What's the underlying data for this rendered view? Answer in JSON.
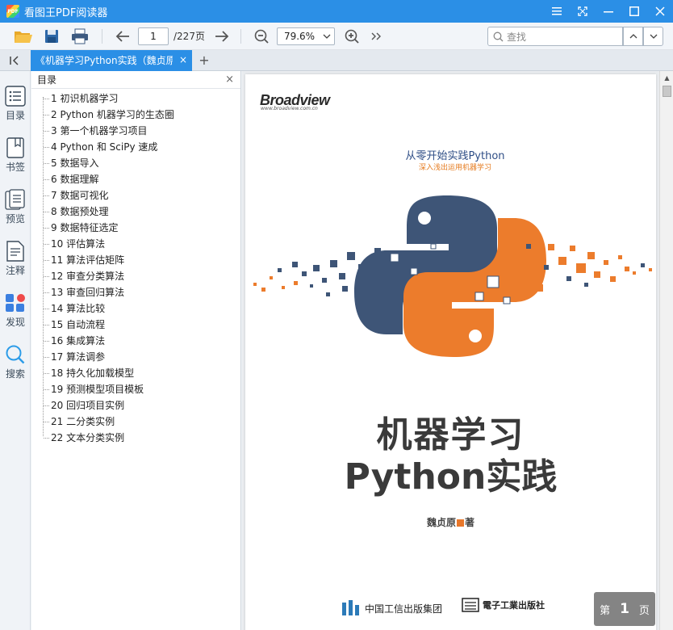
{
  "app": {
    "title": "看图王PDF阅读器",
    "logo_text": "PDF"
  },
  "window_controls": [
    "menu",
    "fullscreen",
    "minimize",
    "maximize",
    "close"
  ],
  "toolbar": {
    "current_page": "1",
    "total_pages": "/227页",
    "zoom": "79.6%",
    "search_placeholder": "查找"
  },
  "tab": {
    "label": "《机器学习Python实践（魏贞原",
    "close": "×",
    "add": "+",
    "collapse": "|<"
  },
  "rail": [
    {
      "label": "目录",
      "icon": "toc-icon"
    },
    {
      "label": "书签",
      "icon": "bookmark-icon"
    },
    {
      "label": "预览",
      "icon": "preview-icon"
    },
    {
      "label": "注释",
      "icon": "annotation-icon"
    },
    {
      "label": "发现",
      "icon": "discover-icon"
    },
    {
      "label": "搜索",
      "icon": "search-icon"
    }
  ],
  "toc": {
    "title": "目录",
    "items": [
      "1 初识机器学习",
      "2 Python 机器学习的生态圈",
      "3 第一个机器学习项目",
      "4 Python 和 SciPy 速成",
      "5 数据导入",
      "6 数据理解",
      "7 数据可视化",
      "8 数据预处理",
      "9 数据特征选定",
      "10 评估算法",
      "11 算法评估矩阵",
      "12 审查分类算法",
      "13 审查回归算法",
      "14 算法比较",
      "15 自动流程",
      "16 集成算法",
      "17 算法调参",
      "18 持久化加载模型",
      "19 预测模型项目模板",
      "20 回归项目实例",
      "21 二分类实例",
      "22 文本分类实例"
    ]
  },
  "cover": {
    "brand": "Broadview",
    "brand_url": "www.broadview.com.cn",
    "subtitle1": "从零开始实践Python",
    "subtitle2": "深入浅出运用机器学习",
    "title_line1": "机器学习",
    "title_line2": "Python实践",
    "author_name": "魏贞原",
    "author_suffix": "著",
    "publisher1": "中国工信出版集团",
    "publisher2": "電子工業出版社",
    "colors": {
      "blue": "#3e5577",
      "orange": "#ec7c2c"
    }
  },
  "page_indicator": {
    "prefix": "第",
    "number": "1",
    "suffix": "页"
  }
}
